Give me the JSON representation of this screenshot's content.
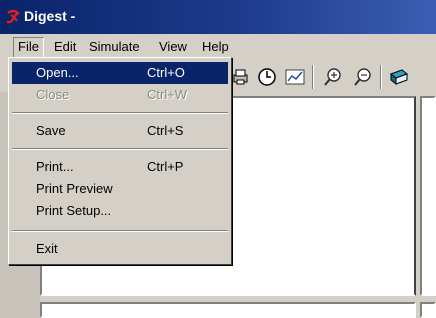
{
  "window": {
    "title": "Digest -",
    "app_icon": "digest-logo-icon"
  },
  "menubar": {
    "items": [
      {
        "label": "File"
      },
      {
        "label": "Edit"
      },
      {
        "label": "Simulate"
      },
      {
        "label": "View"
      },
      {
        "label": "Help"
      }
    ]
  },
  "toolbar": {
    "icons": [
      "print-icon",
      "clock-icon",
      "chart-icon",
      "zoom-in-icon",
      "zoom-out-icon",
      "book-icon"
    ]
  },
  "file_menu": {
    "items": [
      {
        "label": "Open...",
        "shortcut": "Ctrl+O",
        "state": "highlighted"
      },
      {
        "label": "Close",
        "shortcut": "Ctrl+W",
        "state": "disabled"
      },
      {
        "label": "Save",
        "shortcut": "Ctrl+S",
        "state": "enabled"
      },
      {
        "label": "Print...",
        "shortcut": "Ctrl+P",
        "state": "enabled"
      },
      {
        "label": "Print Preview",
        "shortcut": "",
        "state": "enabled"
      },
      {
        "label": "Print Setup...",
        "shortcut": "",
        "state": "enabled"
      },
      {
        "label": "Exit",
        "shortcut": "",
        "state": "enabled"
      }
    ]
  },
  "colors": {
    "titlebar": "#0a246a",
    "highlight": "#0a246a",
    "face": "#d4d0c8"
  }
}
